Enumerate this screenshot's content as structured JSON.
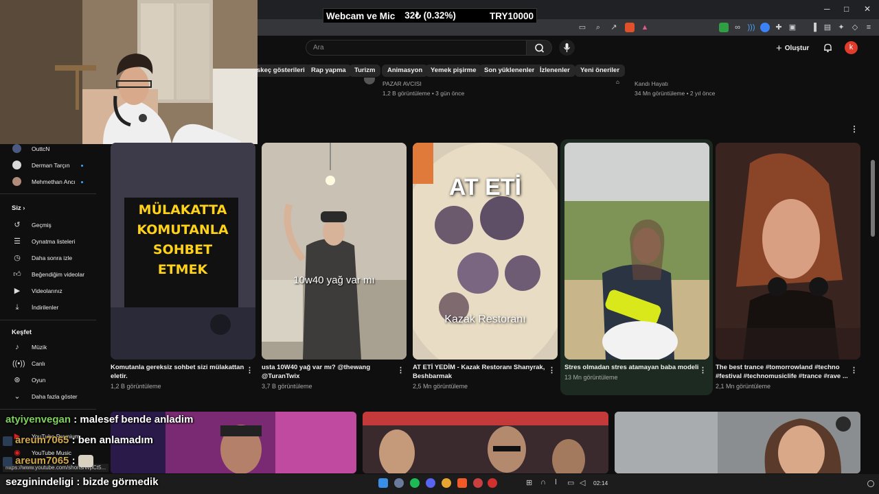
{
  "overlay": {
    "label": "Webcam ve Mic",
    "amount": "32₺ (0.32%)",
    "goal": "TRY10000"
  },
  "window": {
    "minimize": "─",
    "maximize": "□",
    "close": "✕"
  },
  "youtube": {
    "search_placeholder": "Ara",
    "create_label": "Oluştur",
    "avatar_letter": "k",
    "chips": [
      "skeç gösterileri",
      "Rap yapma",
      "Turizm",
      "Animasyon",
      "Yemek pişirme",
      "Son yüklenenler",
      "İzlenenler",
      "Yeni öneriler"
    ]
  },
  "top_videos": [
    {
      "channel": "PAZAR AVCISI",
      "meta": "1,2 B görüntüleme • 3 gün önce"
    },
    {
      "channel": "Kandı Hayatı",
      "meta": "34 Mn görüntüleme • 2 yıl önce"
    }
  ],
  "sidebar": {
    "subscriptions": [
      {
        "label": "OuttcN"
      },
      {
        "label": "Derman Tarçın"
      },
      {
        "label": "Mehmethan Ancı"
      }
    ],
    "you_header": "Siz",
    "you_items": [
      "Geçmiş",
      "Oynatma listeleri",
      "Daha sonra izle",
      "Beğendiğim videolar",
      "Videolarınız",
      "İndirilenler"
    ],
    "explore_header": "Keşfet",
    "explore_items": [
      "Müzik",
      "Canlı",
      "Oyun",
      "Daha fazla göster"
    ],
    "more_items": [
      "YouTube Premium",
      "YouTube Music"
    ]
  },
  "shorts": [
    {
      "title": "Komutanla gereksiz sohbet sizi mülakattan eletir.",
      "views": "1,2 B görüntüleme",
      "overlay_text": [
        "MÜLAKATTA",
        "KOMUTANLA",
        "SOHBET",
        "ETMEK"
      ]
    },
    {
      "title": "usta 10W40 yağ var mı? @thewang @TuranTwix",
      "views": "3,7 B görüntüleme",
      "overlay_text": [
        "10w40 yağ var mı"
      ]
    },
    {
      "title": "AT ETİ YEDİM - Kazak Restoranı Shanyrak, Beshbarmak",
      "views": "2,5 Mn görüntüleme",
      "overlay_text": [
        "AT ETİ",
        "Kazak Restoranı"
      ]
    },
    {
      "title": "Stres olmadan stres atamayan baba modeli",
      "views": "13 Mn görüntüleme",
      "overlay_text": []
    },
    {
      "title": "The best trance #tomorrowland #techno #festival #technomusiclife #trance #rave ...",
      "views": "2,1 Mn görüntüleme",
      "overlay_text": []
    }
  ],
  "status_url": "https://www.youtube.com/shorts/WpCt5...",
  "chat": [
    {
      "user": "atyiyenvegan",
      "message": ": malesef bende anladim"
    },
    {
      "user": "areum7065",
      "message": ": ben anlamadım"
    },
    {
      "user": "areum7065",
      "message": ":"
    },
    {
      "user": "sezginindeligi",
      "message": ": bizde görmedik"
    }
  ],
  "taskbar": {
    "time": "02:14"
  },
  "colors": {
    "chat_green": "#7fd15d",
    "chat_gold": "#d1a84a",
    "youtube_red": "#e03b2b"
  }
}
